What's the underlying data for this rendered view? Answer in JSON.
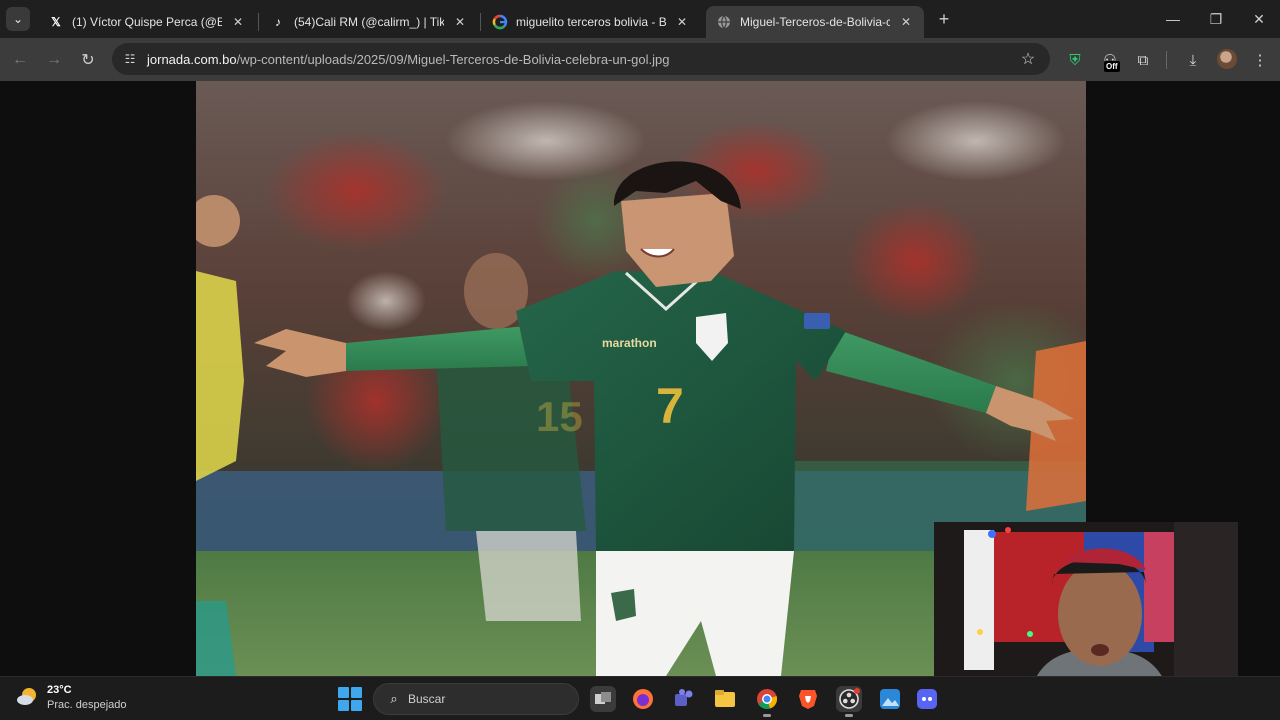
{
  "browser": {
    "tabs": [
      {
        "title": "(1) Víctor Quispe Perca (@Estad",
        "icon": "x-logo-icon",
        "active": false
      },
      {
        "title": "(54)Cali RM (@calirm_) | TikTok",
        "icon": "tiktok-icon",
        "active": false
      },
      {
        "title": "miguelito terceros bolivia - Bus",
        "icon": "google-icon",
        "active": false
      },
      {
        "title": "Miguel-Terceros-de-Bolivia-cele",
        "icon": "globe-icon",
        "active": true
      }
    ],
    "address": {
      "host": "jornada.com.bo",
      "path": "/wp-content/uploads/2025/09/Miguel-Terceros-de-Bolivia-celebra-un-gol.jpg"
    },
    "extension_badge": "Off"
  },
  "image": {
    "jersey_number": "7",
    "sponsor": "marathon"
  },
  "taskbar": {
    "weather": {
      "temp": "23°C",
      "desc": "Prac. despejado"
    },
    "search_placeholder": "Buscar"
  },
  "colors": {
    "jersey_green": "#1f5a40",
    "jersey_gold": "#d8b43a",
    "accent_blue": "#3fa7ee"
  }
}
